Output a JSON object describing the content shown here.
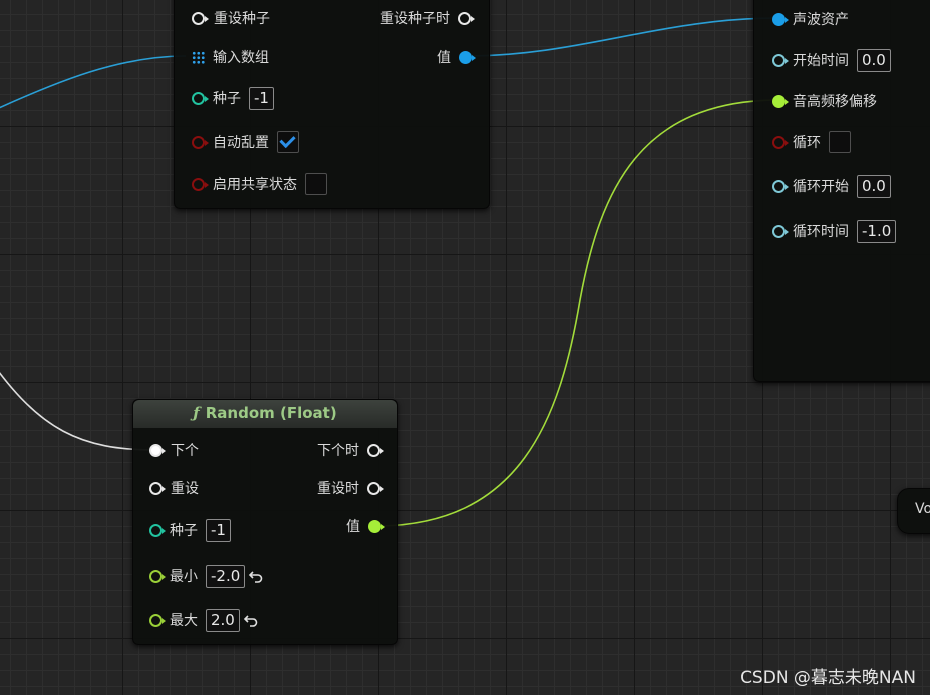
{
  "shuffle_node": {
    "reset_seed": "重设种子",
    "on_reset_seed": "重设种子时",
    "input_array": "输入数组",
    "value": "值",
    "seed": "种子",
    "seed_value": "-1",
    "auto_shuffle": "自动乱置",
    "auto_shuffle_checked": true,
    "enable_shared_state": "启用共享状态",
    "enable_shared_state_checked": false
  },
  "audio_node": {
    "wave_asset": "声波资产",
    "start_time": "开始时间",
    "start_time_value": "0.0",
    "pitch_shift": "音高频移偏移",
    "loop": "循环",
    "loop_checked": false,
    "loop_start": "循环开始",
    "loop_start_value": "0.0",
    "loop_duration": "循环时间",
    "loop_duration_value": "-1.0"
  },
  "random_node": {
    "title": "Random (Float)",
    "title_icon": "ƒ",
    "next": "下个",
    "on_next": "下个时",
    "reset": "重设",
    "on_reset": "重设时",
    "value": "值",
    "seed": "种子",
    "seed_value": "-1",
    "min": "最小",
    "min_value": "-2.0",
    "max": "最大",
    "max_value": "2.0"
  },
  "partial_node": {
    "label": "Vo"
  },
  "watermark": "CSDN @暮志未晚NAN",
  "colors": {
    "exec_pin": "#e8e8e8",
    "int_pin": "#22c3a0",
    "bool_pin": "#8a0e0e",
    "float_pin": "#9ad038",
    "time_pin": "#7ec8d6",
    "object_pin": "#1b9ee8",
    "title_text": "#9dca86"
  }
}
